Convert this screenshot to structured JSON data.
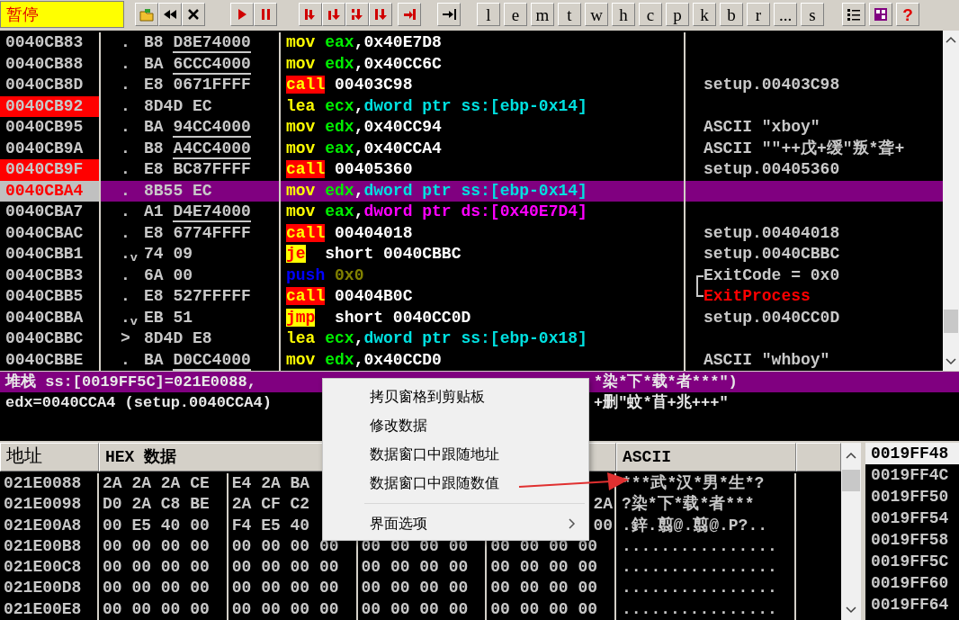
{
  "toolbar": {
    "status": "暂停",
    "letter_buttons": [
      "l",
      "e",
      "m",
      "t",
      "w",
      "h",
      "c",
      "p",
      "k",
      "b",
      "r",
      "...",
      "s"
    ],
    "help": "?"
  },
  "disassembly": {
    "rows": [
      {
        "address": "0040CB83",
        "breakpoint": false,
        "selected": false,
        "marker": ".",
        "opcode": "B8",
        "operand": "D8E74000",
        "fixup": true,
        "mnemonic": "mov",
        "kind": "plain",
        "args": [
          {
            "text": "eax",
            "kind": "reg"
          },
          {
            "text": ",0x40E7D8",
            "kind": "text"
          }
        ]
      },
      {
        "address": "0040CB88",
        "breakpoint": false,
        "selected": false,
        "marker": ".",
        "opcode": "BA",
        "operand": "6CCC4000",
        "fixup": true,
        "mnemonic": "mov",
        "kind": "plain",
        "args": [
          {
            "text": "edx",
            "kind": "reg"
          },
          {
            "text": ",0x40CC6C",
            "kind": "text"
          }
        ]
      },
      {
        "address": "0040CB8D",
        "breakpoint": false,
        "selected": false,
        "marker": ".",
        "opcode": "E8",
        "operand": "0671FFFF",
        "fixup": false,
        "mnemonic": "call",
        "kind": "call",
        "args": [
          {
            "text": "00403C98",
            "kind": "text"
          }
        ],
        "comment": {
          "text": "setup.00403C98",
          "kind": "plain"
        }
      },
      {
        "address": "0040CB92",
        "breakpoint": true,
        "selected": false,
        "marker": ".",
        "opcode": "8D4D",
        "operand": "EC",
        "fixup": false,
        "mnemonic": "lea",
        "kind": "plain",
        "args": [
          {
            "text": "ecx",
            "kind": "reg"
          },
          {
            "text": ",",
            "kind": "text"
          },
          {
            "text": "dword ptr ss:[ebp-0x14]",
            "kind": "mem"
          }
        ]
      },
      {
        "address": "0040CB95",
        "breakpoint": false,
        "selected": false,
        "marker": ".",
        "opcode": "BA",
        "operand": "94CC4000",
        "fixup": true,
        "mnemonic": "mov",
        "kind": "plain",
        "args": [
          {
            "text": "edx",
            "kind": "reg"
          },
          {
            "text": ",0x40CC94",
            "kind": "text"
          }
        ],
        "comment": {
          "text": "ASCII \"xboy\"",
          "kind": "plain"
        }
      },
      {
        "address": "0040CB9A",
        "breakpoint": false,
        "selected": false,
        "marker": ".",
        "opcode": "B8",
        "operand": "A4CC4000",
        "fixup": true,
        "mnemonic": "mov",
        "kind": "plain",
        "args": [
          {
            "text": "eax",
            "kind": "reg"
          },
          {
            "text": ",0x40CCA4",
            "kind": "text"
          }
        ],
        "comment": {
          "text": "ASCII \"\"++戊+缓\"叛*聋+",
          "kind": "plain"
        }
      },
      {
        "address": "0040CB9F",
        "breakpoint": true,
        "selected": false,
        "marker": ".",
        "opcode": "E8",
        "operand": "BC87FFFF",
        "fixup": false,
        "mnemonic": "call",
        "kind": "call",
        "args": [
          {
            "text": "00405360",
            "kind": "text"
          }
        ],
        "comment": {
          "text": "setup.00405360",
          "kind": "plain"
        }
      },
      {
        "address": "0040CBA4",
        "breakpoint": false,
        "selected": true,
        "marker": ".",
        "opcode": "8B55",
        "operand": "EC",
        "fixup": false,
        "mnemonic": "mov",
        "kind": "plain",
        "args": [
          {
            "text": "edx",
            "kind": "reg"
          },
          {
            "text": ",",
            "kind": "text"
          },
          {
            "text": "dword ptr ss:[ebp-0x14]",
            "kind": "mem"
          }
        ]
      },
      {
        "address": "0040CBA7",
        "breakpoint": false,
        "selected": false,
        "marker": ".",
        "opcode": "A1",
        "operand": "D4E74000",
        "fixup": true,
        "mnemonic": "mov",
        "kind": "plain",
        "args": [
          {
            "text": "eax",
            "kind": "reg"
          },
          {
            "text": ",",
            "kind": "text"
          },
          {
            "text": "dword ptr ds:[0x40E7D4]",
            "kind": "mem_ds"
          }
        ]
      },
      {
        "address": "0040CBAC",
        "breakpoint": false,
        "selected": false,
        "marker": ".",
        "opcode": "E8",
        "operand": "6774FFFF",
        "fixup": false,
        "mnemonic": "call",
        "kind": "call",
        "args": [
          {
            "text": "00404018",
            "kind": "text"
          }
        ],
        "comment": {
          "text": "setup.00404018",
          "kind": "plain"
        }
      },
      {
        "address": "0040CBB1",
        "breakpoint": false,
        "selected": false,
        "marker": ".$_{v}$",
        "opcode": "74",
        "operand": "09",
        "fixup": false,
        "mnemonic": "je",
        "kind": "jump",
        "args": [
          {
            "text": " short 0040CBBC",
            "kind": "text"
          }
        ],
        "comment": {
          "text": "setup.0040CBBC",
          "kind": "plain"
        }
      },
      {
        "address": "0040CBB3",
        "breakpoint": false,
        "selected": false,
        "marker": ".",
        "opcode": "6A",
        "operand": "00",
        "fixup": false,
        "mnemonic": "push",
        "kind": "push",
        "args": [
          {
            "text": "0x0",
            "kind": "const"
          }
        ],
        "comment": {
          "text": "ExitCode = 0x0",
          "kind": "plain",
          "bracket_start": true
        }
      },
      {
        "address": "0040CBB5",
        "breakpoint": false,
        "selected": false,
        "marker": ".",
        "opcode": "E8",
        "operand": "527FFFFF",
        "fixup": false,
        "mnemonic": "call",
        "kind": "call",
        "args": [
          {
            "text": "00404B0C",
            "kind": "text"
          }
        ],
        "comment": {
          "text": "ExitProcess",
          "kind": "api",
          "bracket_end": true
        }
      },
      {
        "address": "0040CBBA",
        "breakpoint": false,
        "selected": false,
        "marker": ".$_{v}$",
        "opcode": "EB",
        "operand": "51",
        "fixup": false,
        "mnemonic": "jmp",
        "kind": "jump",
        "args": [
          {
            "text": " short 0040CC0D",
            "kind": "text"
          }
        ],
        "comment": {
          "text": "setup.0040CC0D",
          "kind": "plain"
        }
      },
      {
        "address": "0040CBBC",
        "breakpoint": false,
        "selected": false,
        "marker": ">",
        "opcode": "8D4D",
        "operand": "E8",
        "fixup": false,
        "mnemonic": "lea",
        "kind": "plain",
        "args": [
          {
            "text": "ecx",
            "kind": "reg"
          },
          {
            "text": ",",
            "kind": "text"
          },
          {
            "text": "dword ptr ss:[ebp-0x18]",
            "kind": "mem"
          }
        ]
      },
      {
        "address": "0040CBBE",
        "breakpoint": false,
        "selected": false,
        "marker": ".",
        "opcode": "BA",
        "operand": "D0CC4000",
        "fixup": true,
        "mnemonic": "mov",
        "kind": "plain",
        "args": [
          {
            "text": "edx",
            "kind": "reg"
          },
          {
            "text": ",0x40CCD0",
            "kind": "text"
          }
        ],
        "comment": {
          "text": "ASCII \"whboy\"",
          "kind": "plain"
        }
      }
    ]
  },
  "info": {
    "lines": [
      {
        "highlighted": true,
        "left": "堆栈 ss:[0019FF5C]=021E0088,",
        "right": "*染*下*载*者***\")"
      },
      {
        "highlighted": false,
        "left": "edx=0040CCA4 (setup.0040CCA4)",
        "right": "+删\"蚊*苜+兆+++\""
      }
    ]
  },
  "dump": {
    "columns": [
      "地址",
      "HEX 数据",
      "ASCII"
    ],
    "rows": [
      {
        "address": "021E0088",
        "groups": [
          {
            "text": "2A 2A 2A CE",
            "kind": "head"
          },
          {
            "text": "E4 2A BA",
            "kind": "head"
          }
        ],
        "ascii": "***武*汉*男*生*?"
      },
      {
        "address": "021E0098",
        "groups": [
          {
            "text": "D0 2A C8 BE",
            "kind": "head"
          },
          {
            "text": "2A CF C2",
            "kind": "head"
          },
          {
            "text": "2A",
            "kind": "tail"
          }
        ],
        "ascii": "?染*下*载*者***"
      },
      {
        "address": "021E00A8",
        "groups": [
          {
            "text": "00 E5 40 00",
            "kind": "head"
          },
          {
            "text": "F4 E5 40",
            "kind": "head"
          },
          {
            "text": "00",
            "kind": "tail"
          }
        ],
        "ascii": ".鋅.翦@.翦@.P?.."
      },
      {
        "address": "021E00B8",
        "groups": [
          {
            "text": "00 00 00 00",
            "kind": "head"
          },
          {
            "text": "00 00 00 00",
            "kind": "head"
          },
          {
            "text": "00 00 00 00",
            "kind": "head"
          },
          {
            "text": "00 00 00 00",
            "kind": "head"
          }
        ],
        "ascii": "................"
      },
      {
        "address": "021E00C8",
        "groups": [
          {
            "text": "00 00 00 00",
            "kind": "head"
          },
          {
            "text": "00 00 00 00",
            "kind": "head"
          },
          {
            "text": "00 00 00 00",
            "kind": "head"
          },
          {
            "text": "00 00 00 00",
            "kind": "head"
          }
        ],
        "ascii": "................"
      },
      {
        "address": "021E00D8",
        "groups": [
          {
            "text": "00 00 00 00",
            "kind": "head"
          },
          {
            "text": "00 00 00 00",
            "kind": "head"
          },
          {
            "text": "00 00 00 00",
            "kind": "head"
          },
          {
            "text": "00 00 00 00",
            "kind": "head"
          }
        ],
        "ascii": "................"
      },
      {
        "address": "021E00E8",
        "groups": [
          {
            "text": "00 00 00 00",
            "kind": "head"
          },
          {
            "text": "00 00 00 00",
            "kind": "head"
          },
          {
            "text": "00 00 00 00",
            "kind": "head"
          },
          {
            "text": "00 00 00 00",
            "kind": "head"
          }
        ],
        "ascii": "................"
      }
    ]
  },
  "stack": {
    "items": [
      {
        "address": "0019FF48",
        "selected": true
      },
      {
        "address": "0019FF4C",
        "selected": false
      },
      {
        "address": "0019FF50",
        "selected": false
      },
      {
        "address": "0019FF54",
        "selected": false
      },
      {
        "address": "0019FF58",
        "selected": false
      },
      {
        "address": "0019FF5C",
        "selected": false
      },
      {
        "address": "0019FF60",
        "selected": false
      },
      {
        "address": "0019FF64",
        "selected": false
      }
    ]
  },
  "context_menu": {
    "items": [
      {
        "kind": "item",
        "label": "拷贝窗格到剪贴板",
        "submenu": false
      },
      {
        "kind": "item",
        "label": "修改数据",
        "submenu": false
      },
      {
        "kind": "item",
        "label": "数据窗口中跟随地址",
        "submenu": false
      },
      {
        "kind": "item",
        "label": "数据窗口中跟随数值",
        "submenu": false
      },
      {
        "kind": "separator"
      },
      {
        "kind": "item",
        "label": "界面选项",
        "submenu": true
      }
    ]
  }
}
